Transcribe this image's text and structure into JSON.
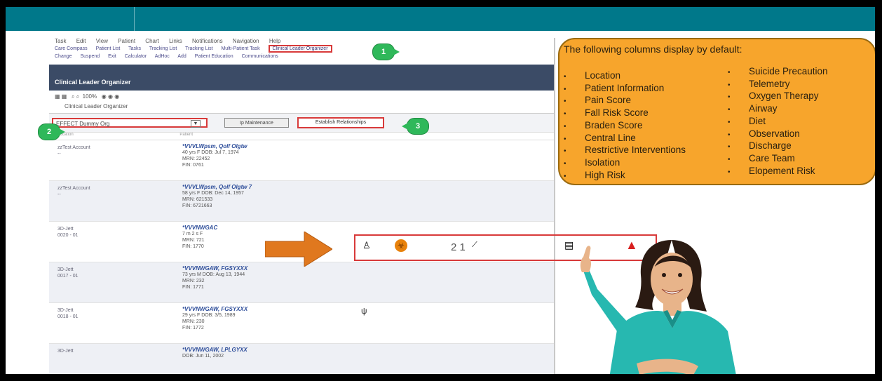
{
  "menubar": [
    "Task",
    "Edit",
    "View",
    "Patient",
    "Chart",
    "Links",
    "Notifications",
    "Navigation",
    "Help"
  ],
  "toolbar1": {
    "items": [
      "Care Compass",
      "Patient List",
      "Tasks",
      "Tracking List",
      "Tracking List",
      "Multi-Patient Task"
    ],
    "highlight": "Clinical Leader Organizer"
  },
  "toolbar2": [
    "Change",
    "Suspend",
    "Exit",
    "Calculator",
    "AdHoc",
    "Add",
    "Patient Education",
    "Communications"
  ],
  "organizer": {
    "title": "Clinical Leader Organizer",
    "zoom": "100%",
    "tab": "Clinical Leader Organizer",
    "filter_value": "EFFECT Dummy Org",
    "btn1": "Ip Maintenance",
    "btn2": "Establish Relationships"
  },
  "columns": [
    "Location",
    "Patient",
    "",
    "",
    "",
    "",
    "",
    ""
  ],
  "rows": [
    {
      "loc1": "zzTest Account",
      "loc2": "--",
      "name": "*VVVLWpsm, Qolf Olgtw",
      "line1": "40 yrs  F  DOB: Jul 7, 1974",
      "line2": "MRN: 22452",
      "line3": "FIN: 0761"
    },
    {
      "loc1": "zzTest Account",
      "loc2": "--",
      "name": "*VVVLWpsm, Qolf Olgtw 7",
      "line1": "58 yrs  F  DOB: Dec 14, 1957",
      "line2": "MRN: 621533",
      "line3": "FIN: 6721663"
    },
    {
      "loc1": "3D-Jett",
      "loc2": "0020 - 01",
      "name": "*VVVNWGAC",
      "line1": "7 m 2 s   F",
      "line2": "MRN: 721",
      "line3": "FIN: 1770"
    },
    {
      "loc1": "3D-Jett",
      "loc2": "0017 - 01",
      "name": "*VVVNWGAW, FGSYXXX",
      "line1": "73 yrs  M  DOB: Aug 13, 1944",
      "line2": "MRN: 232",
      "line3": "FIN: 1771"
    },
    {
      "loc1": "3D-Jett",
      "loc2": "0018 - 01",
      "name": "*VVVNWGAW, FGSYXXX",
      "line1": "29 yrs  F  DOB: 3/5, 1989",
      "line2": "MRN: 230",
      "line3": "FIN: 1772"
    },
    {
      "loc1": "3D-Jett",
      "loc2": "",
      "name": "*VVVNWGAW, LPLGYXX",
      "line1": "DOB: Jun 11, 2002",
      "line2": "",
      "line3": ""
    }
  ],
  "markers": {
    "m1": "1",
    "m2": "2",
    "m3": "3"
  },
  "highlight_row_text": "2 1",
  "callout": {
    "title": "The following columns display by default:",
    "left": [
      "Location",
      "Patient Information",
      "Pain Score",
      "Fall Risk Score",
      "Braden Score",
      "Central Line",
      "Restrictive Interventions",
      "Isolation",
      "High Risk"
    ],
    "right": [
      "Suicide Precaution",
      "Telemetry",
      "Oxygen Therapy",
      "Airway",
      "Diet",
      "Observation",
      "Discharge",
      "Care Team",
      "Elopement Risk"
    ]
  },
  "colors": {
    "teal": "#00788a",
    "orange": "#f7a52c",
    "green": "#2fb85a",
    "red": "#d83a3a",
    "arrow": "#e0781e"
  },
  "icons": [
    "bed-icon",
    "biohazard-icon",
    "clipboard-icon",
    "warning-icon",
    "fork-knife-icon",
    "person-icon",
    "id-card-icon"
  ]
}
